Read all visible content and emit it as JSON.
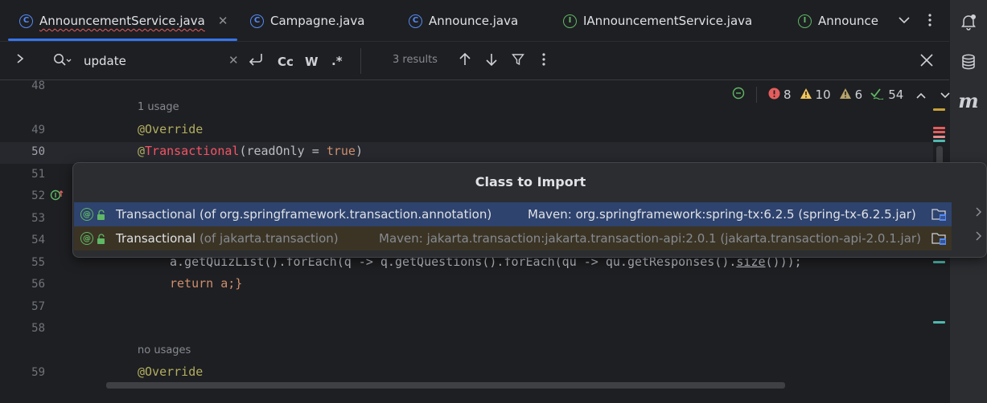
{
  "tabs": [
    {
      "label": "AnnouncementService.java",
      "icon": "class-icon",
      "active": true
    },
    {
      "label": "Campagne.java",
      "icon": "class-icon"
    },
    {
      "label": "Announce.java",
      "icon": "class-icon"
    },
    {
      "label": "IAnnouncementService.java",
      "icon": "interface-icon"
    },
    {
      "label": "Announce",
      "icon": "interface-icon"
    }
  ],
  "tab_icon_letters": {
    "class": "C",
    "interface": "I"
  },
  "search": {
    "value": "update",
    "case_label": "Cc",
    "word_label": "W",
    "regex_label": ".*",
    "results": "3 results"
  },
  "inspections": {
    "errors": "8",
    "warnings": "10",
    "weak_warnings": "6",
    "ok": "54"
  },
  "gutter": {
    "line_48": "48",
    "line_49": "49",
    "line_50": "50",
    "line_51": "51",
    "line_52": "52",
    "line_53": "53",
    "line_54": "54",
    "line_55": "55",
    "line_56": "56",
    "line_57": "57",
    "line_58": "58",
    "line_59": "59"
  },
  "code": {
    "usage_hint_1": "1 usage",
    "override_1": "@Override",
    "transactional_at": "@",
    "transactional_name": "Transactional",
    "transactional_args_open": "(readOnly = ",
    "transactional_true": "true",
    "transactional_args_close": ")",
    "line55_pre": "a.getQuizList().forEach(q -> q.getQuestions().forEach(qu -> qu.getResponses().",
    "line55_fn": "size",
    "line55_post": "()));",
    "line56": "return a;}",
    "usage_hint_2": "no usages",
    "override_2": "@Override"
  },
  "popup": {
    "title": "Class to Import",
    "items": [
      {
        "name": "Transactional",
        "qualifier": "(of org.springframework.transaction.annotation)",
        "location": "Maven: org.springframework:spring-tx:6.2.5 (spring-tx-6.2.5.jar)"
      },
      {
        "name": "Transactional",
        "qualifier": "(of jakarta.transaction)",
        "location": "Maven: jakarta.transaction:jakarta.transaction-api:2.0.1 (jakarta.transaction-api-2.0.1.jar)"
      }
    ]
  },
  "colors": {
    "selected_row": "#2e436e",
    "alt_row": "#3b3425",
    "accent": "#3574f0",
    "annotation": "#b3ae60",
    "keyword": "#cf8e6d",
    "error": "#f75464"
  }
}
